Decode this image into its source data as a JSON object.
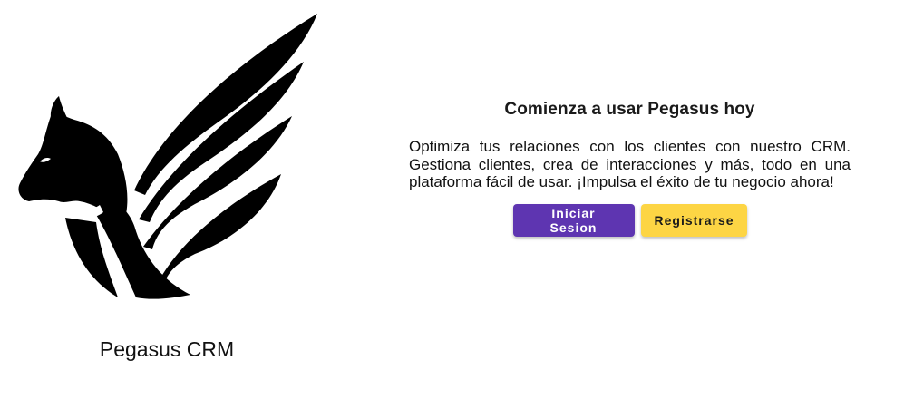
{
  "brand": {
    "name": "Pegasus CRM",
    "logo_icon": "pegasus-logo-icon"
  },
  "hero": {
    "title": "Comienza a usar Pegasus hoy",
    "description": "Optimiza tus relaciones con los clientes con nuestro CRM. Gestiona clientes, crea de interacciones y más, todo en una plataforma fácil de usar. ¡Impulsa el éxito de tu negocio ahora!"
  },
  "actions": {
    "login_label": "Iniciar Sesion",
    "register_label": "Registrarse"
  },
  "colors": {
    "primary": "#5e35b1",
    "accent": "#fdd544",
    "text": "#111111"
  }
}
